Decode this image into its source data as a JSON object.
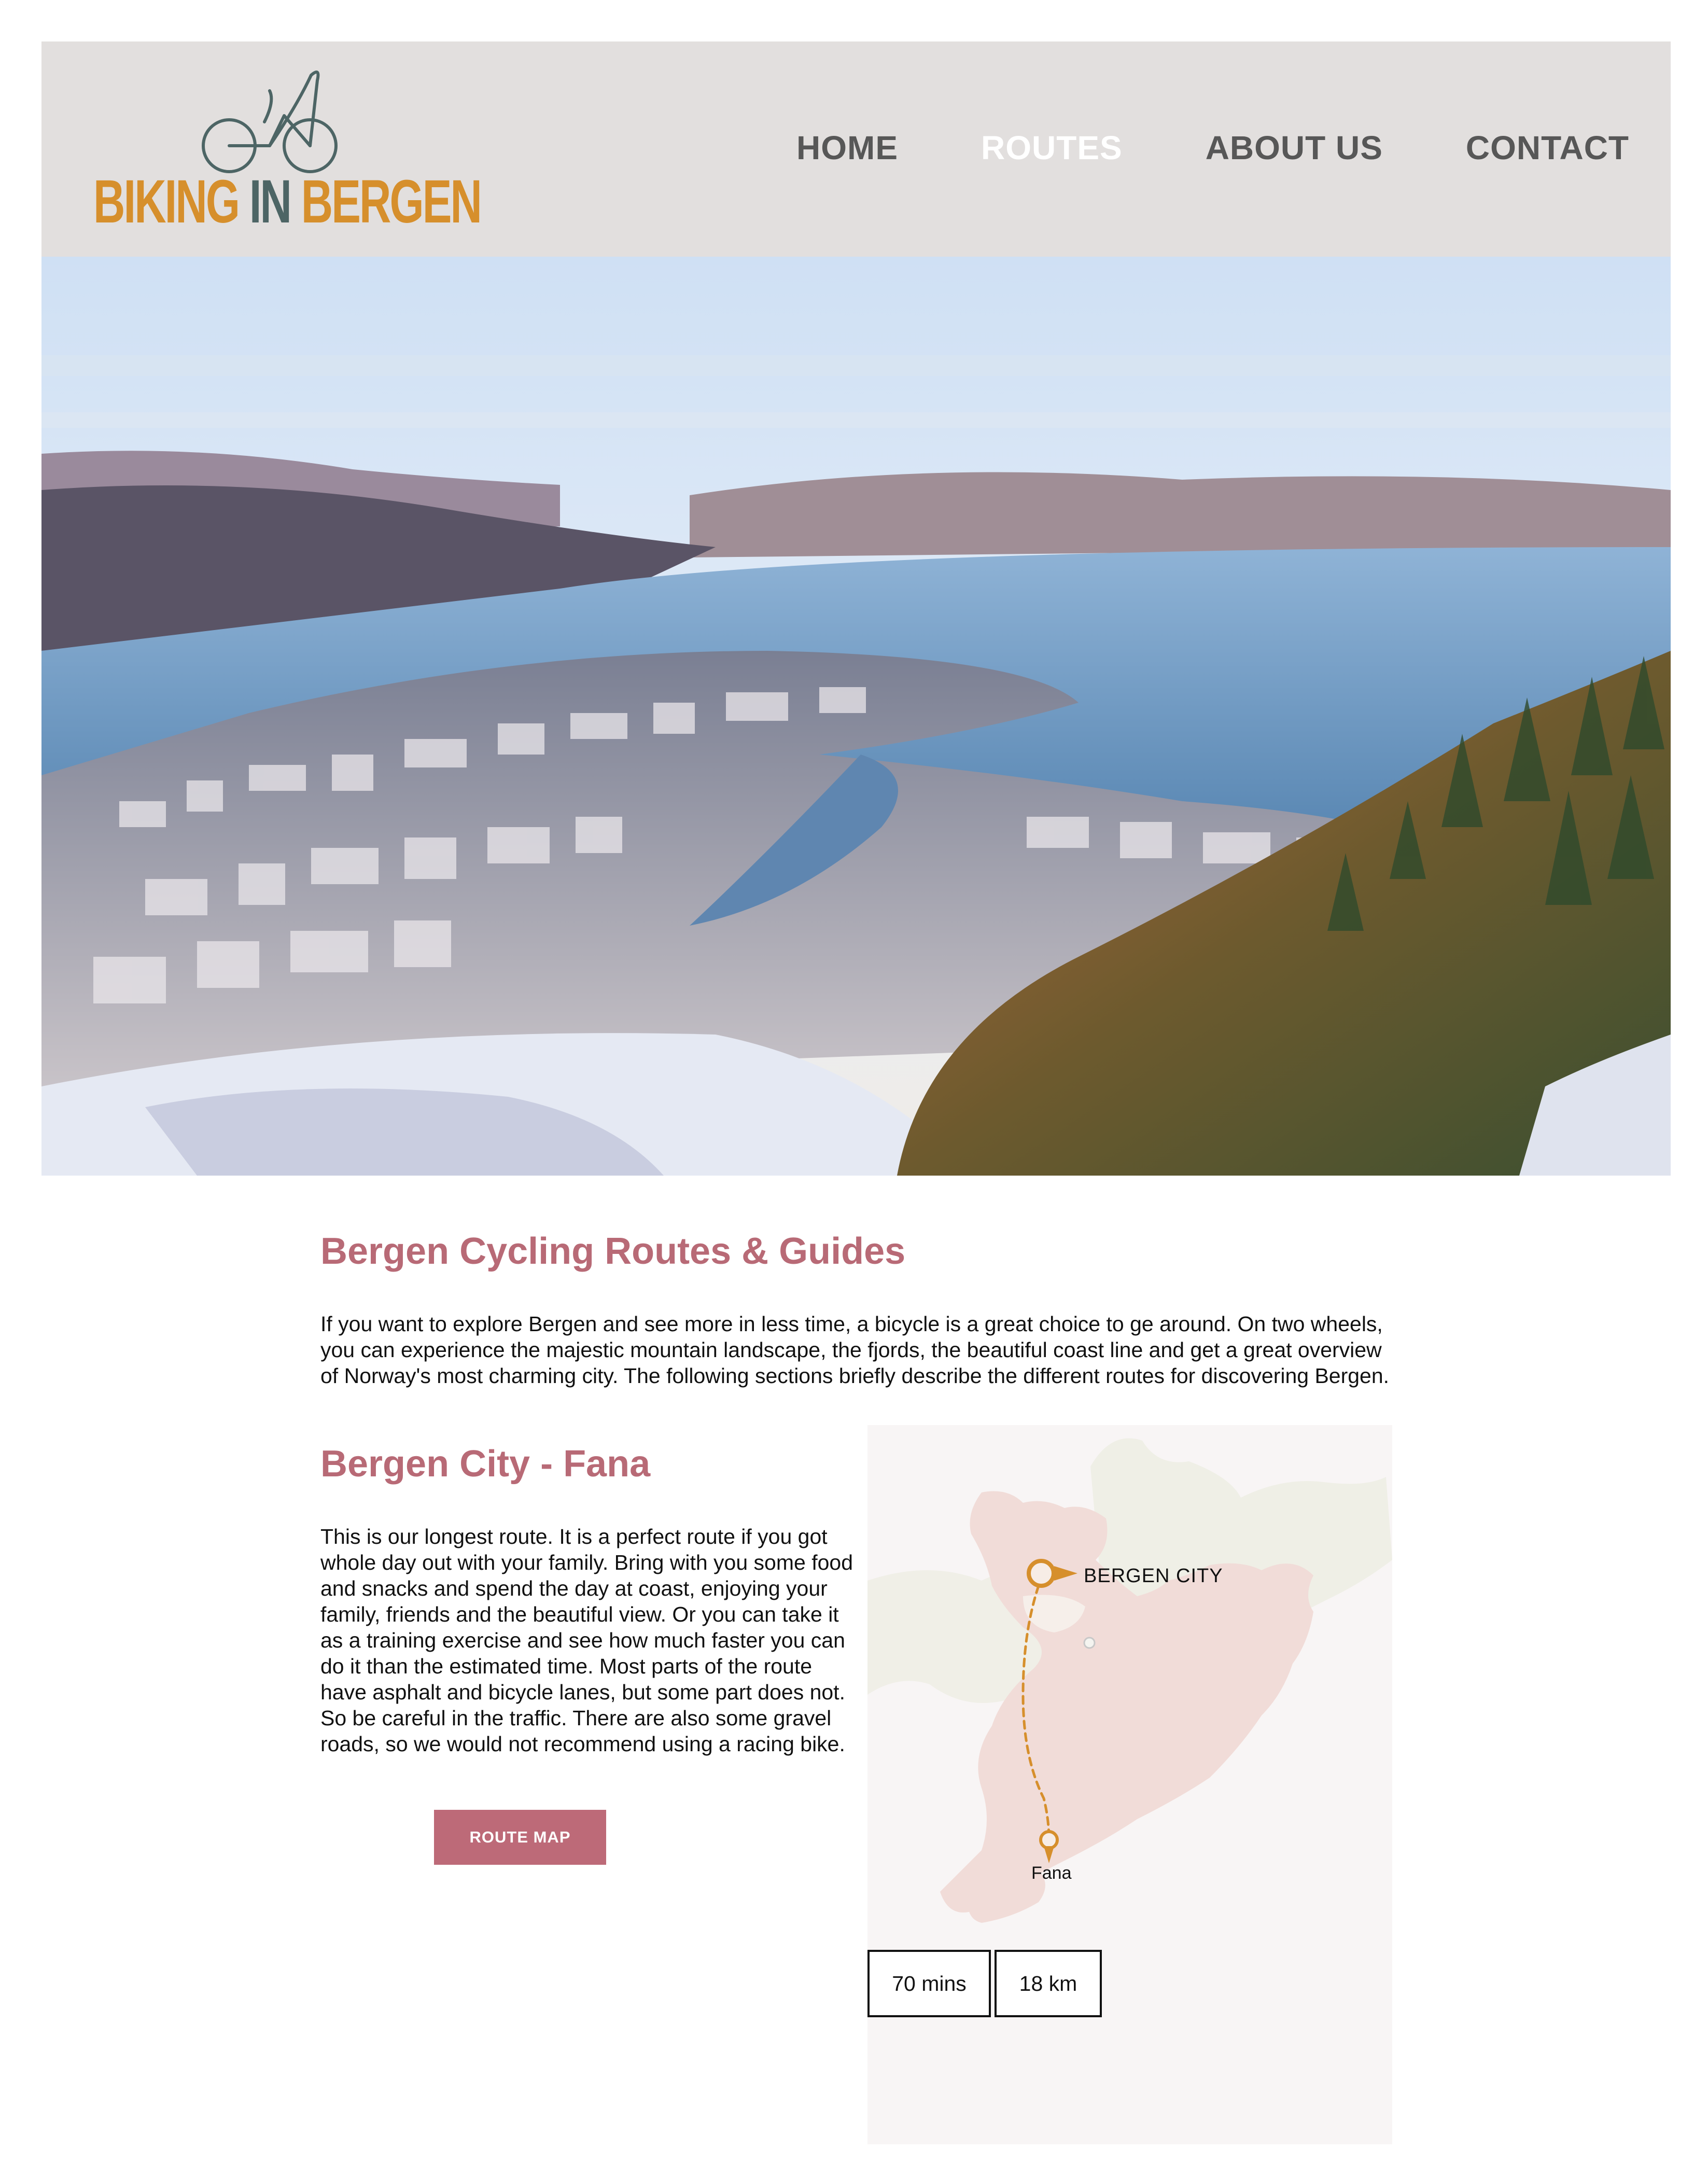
{
  "brand": {
    "logo_part1": "BIKING",
    "logo_part2": "IN",
    "logo_part3": "BERGEN",
    "color_primary": "#d68f2c",
    "color_secondary": "#4d6565"
  },
  "nav": {
    "items": [
      {
        "label": "HOME",
        "active": false
      },
      {
        "label": "ROUTES",
        "active": true
      },
      {
        "label": "ABOUT US",
        "active": false
      },
      {
        "label": "CONTACT",
        "active": false
      }
    ]
  },
  "intro": {
    "title": "Bergen Cycling Routes & Guides",
    "text": "If you want to explore Bergen and see more in less time, a bicycle is a great choice to ge around. On two wheels, you can experience the majestic mountain landscape, the fjords, the beautiful coast line and get a great overview of Norway's most charming city. The following sections briefly describe the different routes for discovering Bergen."
  },
  "route": {
    "title": "Bergen City - Fana",
    "text": "This is our longest route. It is a perfect route if you got whole day out with your family. Bring with you some food and snacks and spend the day at coast, enjoying your family, friends and the beautiful view. Or you can take it as a training exercise and see how much faster you can do it than the estimated time. Most parts of the route have asphalt and bicycle lanes, but some part does not. So be careful in the traffic. There are also some gravel roads, so we would not recommend using a racing bike.",
    "button_label": "ROUTE MAP",
    "map": {
      "start_label": "BERGEN CITY",
      "end_label": "Fana",
      "route_color": "#d68f2c"
    },
    "duration": "70 mins",
    "distance": "18 km"
  },
  "colors": {
    "header_bg": "#e2dfde",
    "heading": "#b86a76",
    "button_bg": "#bd6a78"
  }
}
